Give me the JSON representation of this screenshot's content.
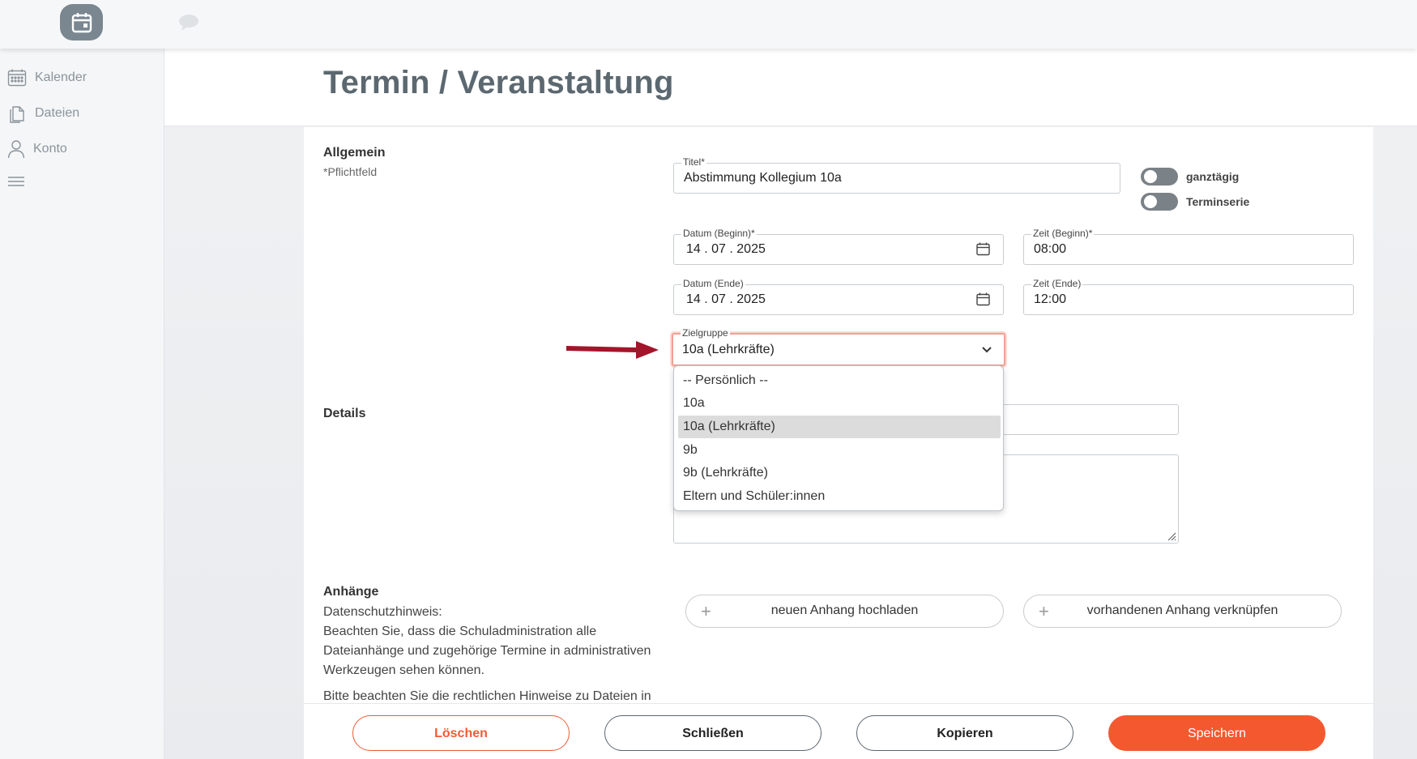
{
  "topbar": {
    "logo_icon": "calendar-icon",
    "chat_icon": "chat-bubble-icon"
  },
  "sidebar": {
    "items": [
      {
        "label": "Kalender",
        "icon": "calendar-grid-icon"
      },
      {
        "label": "Dateien",
        "icon": "files-icon"
      },
      {
        "label": "Konto",
        "icon": "user-icon"
      },
      {
        "label": "",
        "icon": "menu-icon"
      }
    ]
  },
  "page": {
    "title": "Termin / Veranstaltung"
  },
  "general": {
    "section_title": "Allgemein",
    "required_hint": "*Pflichtfeld",
    "title_field": {
      "label": "Titel*",
      "value": "Abstimmung Kollegium 10a"
    },
    "toggles": {
      "all_day": "ganztägig",
      "series": "Terminserie"
    },
    "date_start": {
      "label": "Datum (Beginn)*",
      "value": "14 . 07 . 2025"
    },
    "time_start": {
      "label": "Zeit (Beginn)*",
      "value": "08:00"
    },
    "date_end": {
      "label": "Datum (Ende)",
      "value": "14 . 07 . 2025"
    },
    "time_end": {
      "label": "Zeit (Ende)",
      "value": "12:00"
    },
    "target_group": {
      "label": "Zielgruppe",
      "value": "10a (Lehrkräfte)",
      "options": [
        "-- Persönlich --",
        "10a",
        "10a (Lehrkräfte)",
        "9b",
        "9b (Lehrkräfte)",
        "Eltern und Schüler:innen"
      ]
    }
  },
  "details": {
    "section_title": "Details"
  },
  "attachments": {
    "section_title": "Anhänge",
    "privacy_title": "Datenschutzhinweis:",
    "privacy_text": "Beachten Sie, dass die Schuladministration alle Dateianhänge und zugehörige Termine in administrativen Werkzeugen sehen können.",
    "legal_text": "Bitte beachten Sie die rechtlichen Hinweise zu Dateien in",
    "upload_button": "neuen Anhang hochladen",
    "link_button": "vorhandenen Anhang verknüpfen"
  },
  "footer": {
    "delete": "Löschen",
    "close": "Schließen",
    "copy": "Kopieren",
    "save": "Speichern"
  },
  "colors": {
    "accent": "#f4582f",
    "logo_bg": "#7a8791",
    "arrow": "#a3152a"
  }
}
